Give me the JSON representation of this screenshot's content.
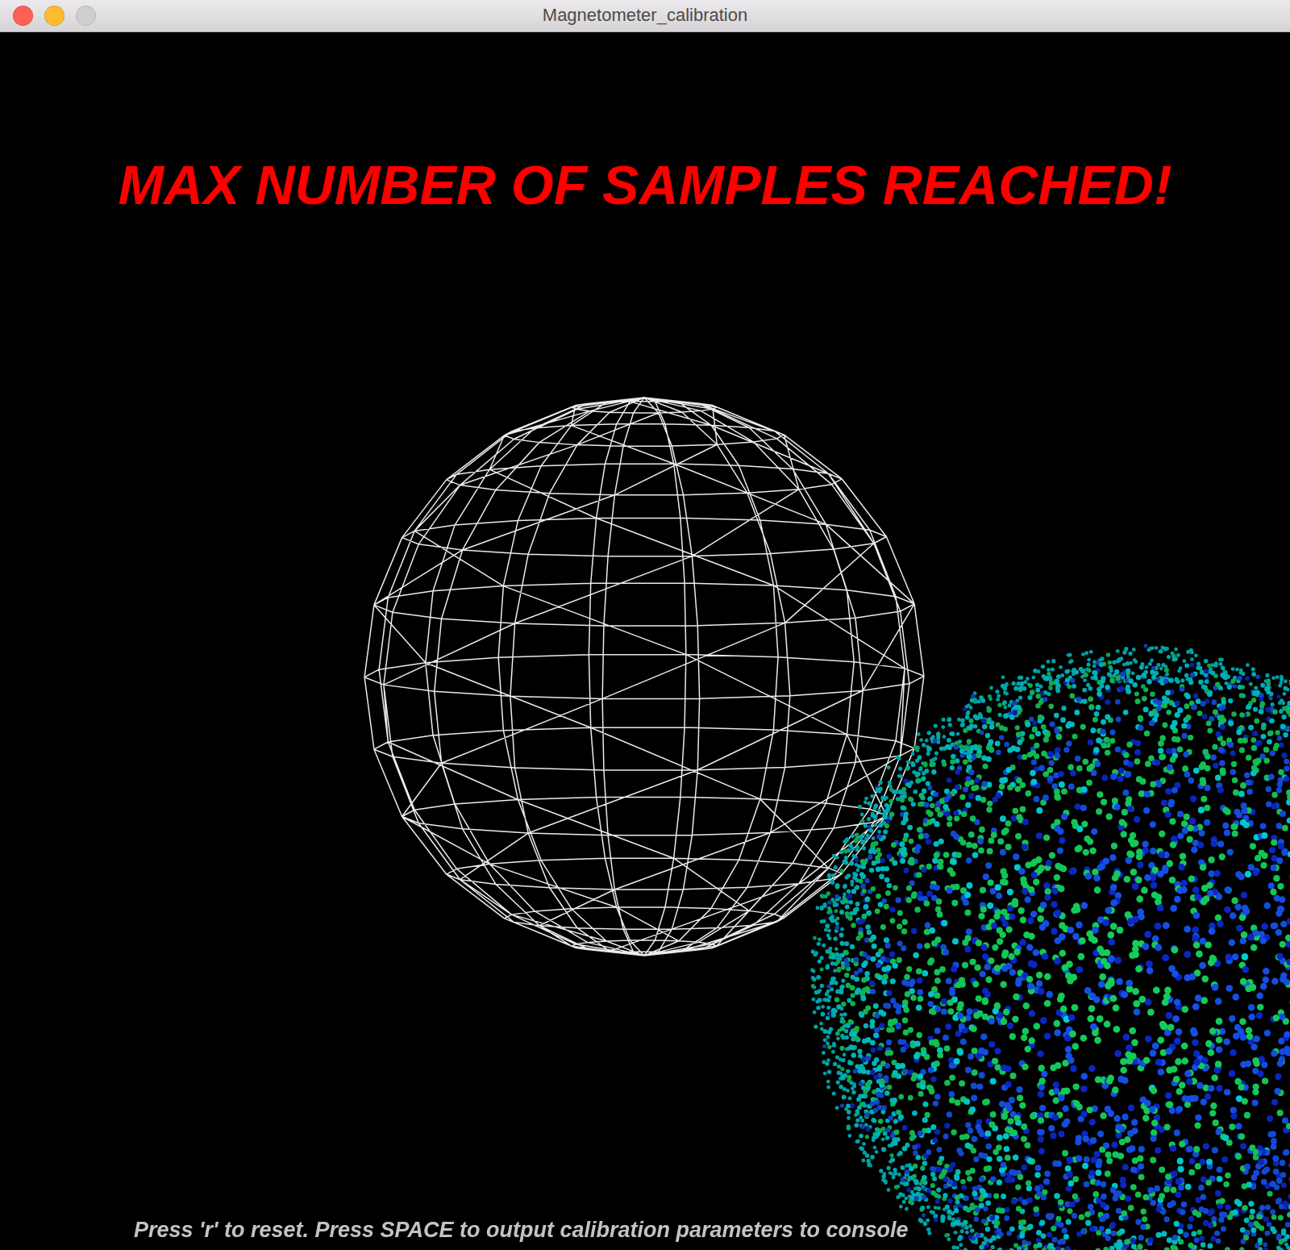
{
  "window": {
    "title": "Magnetometer_calibration",
    "buttons": [
      {
        "kind": "close",
        "color": "#fe5f57",
        "disabled": false
      },
      {
        "kind": "minimize",
        "color": "#febc2e",
        "disabled": false
      },
      {
        "kind": "zoom",
        "color": "#cfcdcf",
        "disabled": true
      }
    ]
  },
  "status": {
    "message": "MAX NUMBER OF SAMPLES REACHED!"
  },
  "hint": {
    "text": "Press 'r' to reset. Press SPACE to output calibration parameters to console"
  }
}
